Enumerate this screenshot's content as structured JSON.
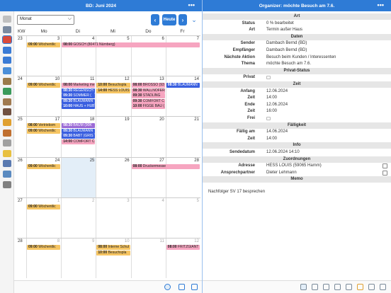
{
  "left_title": "BD: Juni 2024",
  "right_title": "Organizer: möchte Besuch am 7.6.",
  "more_icon": "•••",
  "view_select": "Monat",
  "today_button": "Heute",
  "prev_icon": "‹",
  "next_icon": "›",
  "collapse_icon": "⌄",
  "calendar": {
    "kw_header": "KW",
    "weekdays": [
      "Mo",
      "Di",
      "Mi",
      "Do",
      "Fr"
    ],
    "weeks": [
      {
        "kw": "23",
        "days": [
          "3",
          "4",
          "5",
          "6",
          "7"
        ],
        "events": [
          {
            "col": 0,
            "row": 0,
            "span": 1,
            "time": "09:00",
            "text": "Wöchentlic",
            "color": "orange"
          },
          {
            "col": 1,
            "row": 0,
            "span": 4,
            "time": "08:00",
            "text": "GOSCH (80471 Nürnberg)",
            "color": "pink"
          }
        ]
      },
      {
        "kw": "24",
        "days": [
          "10",
          "11",
          "12",
          "13",
          "14"
        ],
        "events": [
          {
            "col": 0,
            "row": 0,
            "span": 1,
            "time": "09:00",
            "text": "Wöchentlic",
            "color": "orange"
          },
          {
            "col": 1,
            "row": 0,
            "span": 1,
            "time": "08:00",
            "text": "Marketing me",
            "color": "pink"
          },
          {
            "col": 1,
            "row": 1,
            "span": 1,
            "time": "08:30",
            "text": "REGENSCH",
            "color": "blue"
          },
          {
            "col": 1,
            "row": 2,
            "span": 1,
            "time": "09:30",
            "text": "SOMMER (",
            "color": "blue"
          },
          {
            "col": 1,
            "row": 3,
            "span": 1,
            "time": "09:30",
            "text": "BLAUMANN",
            "color": "blue"
          },
          {
            "col": 1,
            "row": 4,
            "span": 1,
            "time": "10:00",
            "text": "HAUS + HUB",
            "color": "blue"
          },
          {
            "col": 2,
            "row": 0,
            "span": 1,
            "time": "10:00",
            "text": "Besuchspla",
            "color": "orange"
          },
          {
            "col": 2,
            "row": 1,
            "span": 1,
            "time": "14:00",
            "text": "HESS LOUIS",
            "color": "orange"
          },
          {
            "col": 3,
            "row": 0,
            "span": 1,
            "time": "08:00",
            "text": "BROSSO (93",
            "color": "pink"
          },
          {
            "col": 3,
            "row": 1,
            "span": 1,
            "time": "08:30",
            "text": "WALLNÖFER",
            "color": "pink"
          },
          {
            "col": 3,
            "row": 2,
            "span": 1,
            "time": "09:30",
            "text": "STADLING",
            "color": "pink"
          },
          {
            "col": 3,
            "row": 3,
            "span": 1,
            "time": "09:30",
            "text": "COMFORT C",
            "color": "pink"
          },
          {
            "col": 3,
            "row": 4,
            "span": 1,
            "time": "10:00",
            "text": "FIGGE BAU (",
            "color": "pink"
          },
          {
            "col": 4,
            "row": 0,
            "span": 1,
            "time": "08:30",
            "text": "BLAUMANN",
            "color": "blue"
          }
        ]
      },
      {
        "kw": "25",
        "days": [
          "17",
          "18",
          "19",
          "20",
          "21"
        ],
        "events": [
          {
            "col": 0,
            "row": 0,
            "span": 1,
            "time": "08:00",
            "text": "Vertriebsm",
            "color": "orange"
          },
          {
            "col": 0,
            "row": 1,
            "span": 1,
            "time": "09:00",
            "text": "Wöchentlic",
            "color": "orange"
          },
          {
            "col": 1,
            "row": 0,
            "span": 1,
            "time": "08:30",
            "text": "BAUM (90K",
            "color": "purple"
          },
          {
            "col": 1,
            "row": 1,
            "span": 1,
            "time": "09:30",
            "text": "BLAUMANN",
            "color": "blue"
          },
          {
            "col": 1,
            "row": 2,
            "span": 1,
            "time": "09:30",
            "text": "BABT (GRIS",
            "color": "blue"
          },
          {
            "col": 1,
            "row": 3,
            "span": 1,
            "time": "14:00",
            "text": "COMFORT C",
            "color": "pink"
          }
        ]
      },
      {
        "kw": "26",
        "days": [
          "24",
          "25",
          "26",
          "27",
          "28"
        ],
        "today": 1,
        "events": [
          {
            "col": 0,
            "row": 0,
            "span": 1,
            "time": "09:00",
            "text": "Wöchentlic",
            "color": "orange"
          },
          {
            "col": 3,
            "row": 0,
            "span": 2,
            "time": "08:00",
            "text": "Druckermesse",
            "color": "pink"
          }
        ]
      },
      {
        "kw": "27",
        "days": [
          "1",
          "2",
          "3",
          "4",
          "5"
        ],
        "other": true,
        "events": [
          {
            "col": 0,
            "row": 0,
            "span": 1,
            "time": "09:00",
            "text": "Wöchentlic",
            "color": "orange"
          }
        ]
      },
      {
        "kw": "28",
        "days": [
          "8",
          "9",
          "10",
          "11",
          "12"
        ],
        "other": true,
        "events": [
          {
            "col": 0,
            "row": 0,
            "span": 1,
            "time": "09:00",
            "text": "Wöchentlic",
            "color": "orange"
          },
          {
            "col": 2,
            "row": 0,
            "span": 1,
            "time": "08:00",
            "text": "Interne Schul",
            "color": "orange"
          },
          {
            "col": 2,
            "row": 1,
            "span": 1,
            "time": "10:00",
            "text": "Besuchspla",
            "color": "orange"
          },
          {
            "col": 4,
            "row": 0,
            "span": 1,
            "time": "08:00",
            "text": "FRITZGIANT (",
            "color": "pink"
          }
        ]
      }
    ]
  },
  "organizer": {
    "sections": [
      {
        "title": "Art",
        "rows": [
          {
            "label": "Status",
            "value": "0 % bearbeitet"
          },
          {
            "label": "Art",
            "value": "Termin außer Haus"
          }
        ]
      },
      {
        "title": "Daten",
        "rows": [
          {
            "label": "Sender",
            "value": "Dambach Bernd (BD)"
          },
          {
            "label": "Empfänger",
            "value": "Dambach Bernd (BD)"
          },
          {
            "label": "Nächste Aktion",
            "value": "Besuch beim Kunden / Interessenten"
          },
          {
            "label": "Thema",
            "value": "möchte Besuch am 7.6."
          }
        ]
      },
      {
        "title": "Privat-Status",
        "rows": [
          {
            "label": "Privat",
            "value": "",
            "checkbox": true
          }
        ]
      },
      {
        "title": "Zeit",
        "rows": [
          {
            "label": "Anfang",
            "value": "12.06.2024"
          },
          {
            "label": "Zeit",
            "value": "14:00"
          },
          {
            "label": "Ende",
            "value": "12.06.2024"
          },
          {
            "label": "Zeit",
            "value": "16:00"
          },
          {
            "label": "Frei",
            "value": "",
            "checkbox": true
          }
        ]
      },
      {
        "title": "Fälligkeit",
        "rows": [
          {
            "label": "Fällig am",
            "value": "14.06.2024"
          },
          {
            "label": "Zeit",
            "value": "14:00"
          }
        ]
      },
      {
        "title": "Info",
        "rows": [
          {
            "label": "Sendedatum",
            "value": "12.06.2024 14:10"
          }
        ]
      },
      {
        "title": "Zuordnungen",
        "rows": [
          {
            "label": "Adresse",
            "value": "HESS LOUIS (59065 Hamm)",
            "icon": true
          },
          {
            "label": "Ansprechpartner",
            "value": "Dieter Lehmann",
            "icon": true
          }
        ]
      },
      {
        "title": "Memo",
        "rows": []
      }
    ],
    "memo": "Nachfolger SV 17 besprechen"
  },
  "rail_icons": [
    "home-icon",
    "list-icon",
    "clock-icon",
    "calendar-icon",
    "stack-icon",
    "mail-icon",
    "tools-icon",
    "table-icon",
    "bag-icon",
    "briefcase-icon",
    "euro-icon",
    "boxes-icon",
    "doc-icon",
    "bulb-icon",
    "people-icon",
    "grid-icon",
    "gear-icon"
  ],
  "colors": {
    "accent": "#2e7bd6",
    "pink": "#f6a5c0",
    "orange": "#f6c563",
    "blue": "#3a5fe0",
    "purple": "#9b6ad6"
  }
}
